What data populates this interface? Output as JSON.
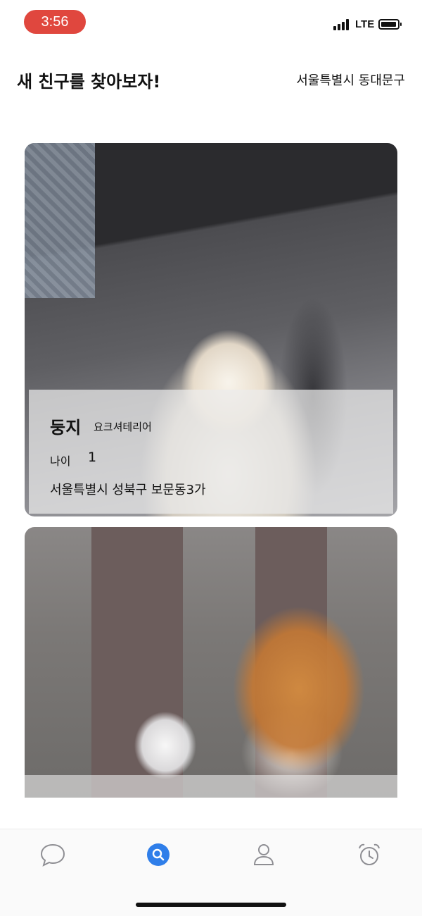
{
  "status_bar": {
    "time": "3:56",
    "network": "LTE"
  },
  "header": {
    "title": "새 친구를 찾아보자!",
    "location": "서울특별시 동대문구"
  },
  "cards": [
    {
      "photo": "yorkshire-terrier-photo",
      "name": "둥지",
      "breed": "요크셔테리어",
      "age_label": "나이",
      "age": "1",
      "address": "서울특별시 성북구 보문동3가"
    },
    {
      "photo": "orange-tabby-cat-photo"
    }
  ],
  "tab_bar": {
    "items": [
      {
        "icon": "chat-bubble-icon",
        "active": false
      },
      {
        "icon": "search-icon",
        "active": true
      },
      {
        "icon": "profile-icon",
        "active": false
      },
      {
        "icon": "alarm-clock-icon",
        "active": false
      }
    ],
    "accent_color": "#2f7ee9",
    "inactive_color": "#8e8e93"
  }
}
